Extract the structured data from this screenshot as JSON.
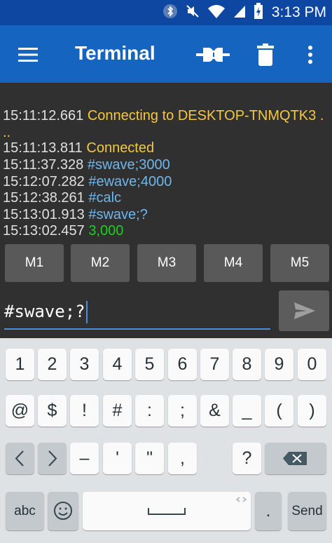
{
  "status_bar": {
    "time": "3:13 PM",
    "icons": [
      "bluetooth-icon",
      "mute-icon",
      "wifi-icon",
      "cellular-signal-icon",
      "battery-charging-icon"
    ]
  },
  "app_bar": {
    "title": "Terminal",
    "icons": [
      "menu-icon",
      "connect-icon",
      "trash-icon",
      "more-vert-icon"
    ]
  },
  "terminal_lines": [
    {
      "time": "15:11:12.661",
      "text": "Connecting to DESKTOP-TNMQTK3 .",
      "kind": "status"
    },
    {
      "time": "",
      "text": "..",
      "kind": "status"
    },
    {
      "time": "15:11:13.811",
      "text": "Connected",
      "kind": "status"
    },
    {
      "time": "15:11:37.328",
      "text": "#swave;3000",
      "kind": "sent"
    },
    {
      "time": "15:12:07.282",
      "text": "#ewave;4000",
      "kind": "sent"
    },
    {
      "time": "15:12:38.261",
      "text": "#calc",
      "kind": "sent"
    },
    {
      "time": "15:13:01.913",
      "text": "#swave;?",
      "kind": "sent"
    },
    {
      "time": "15:13:02.457",
      "text": "3,000",
      "kind": "received"
    }
  ],
  "macros": [
    "M1",
    "M2",
    "M3",
    "M4",
    "M5"
  ],
  "input": {
    "value": "#swave;?"
  },
  "keyboard": {
    "row1": [
      "1",
      "2",
      "3",
      "4",
      "5",
      "6",
      "7",
      "8",
      "9",
      "0"
    ],
    "row2": [
      "@",
      "$",
      "!",
      "#",
      ":",
      ";",
      "&",
      "_",
      "(",
      ")"
    ],
    "row3": [
      "<",
      ">",
      "–",
      "'",
      "\"",
      ",",
      "?"
    ],
    "abc_label": "abc",
    "send_label": "Send",
    "period_label": "."
  },
  "colors": {
    "status_bar": "#0d47a1",
    "app_bar": "#1565c0",
    "terminal_bg": "#303030",
    "status_text": "#f5c842",
    "sent_text": "#6fb6ec",
    "received_text": "#19d219"
  }
}
